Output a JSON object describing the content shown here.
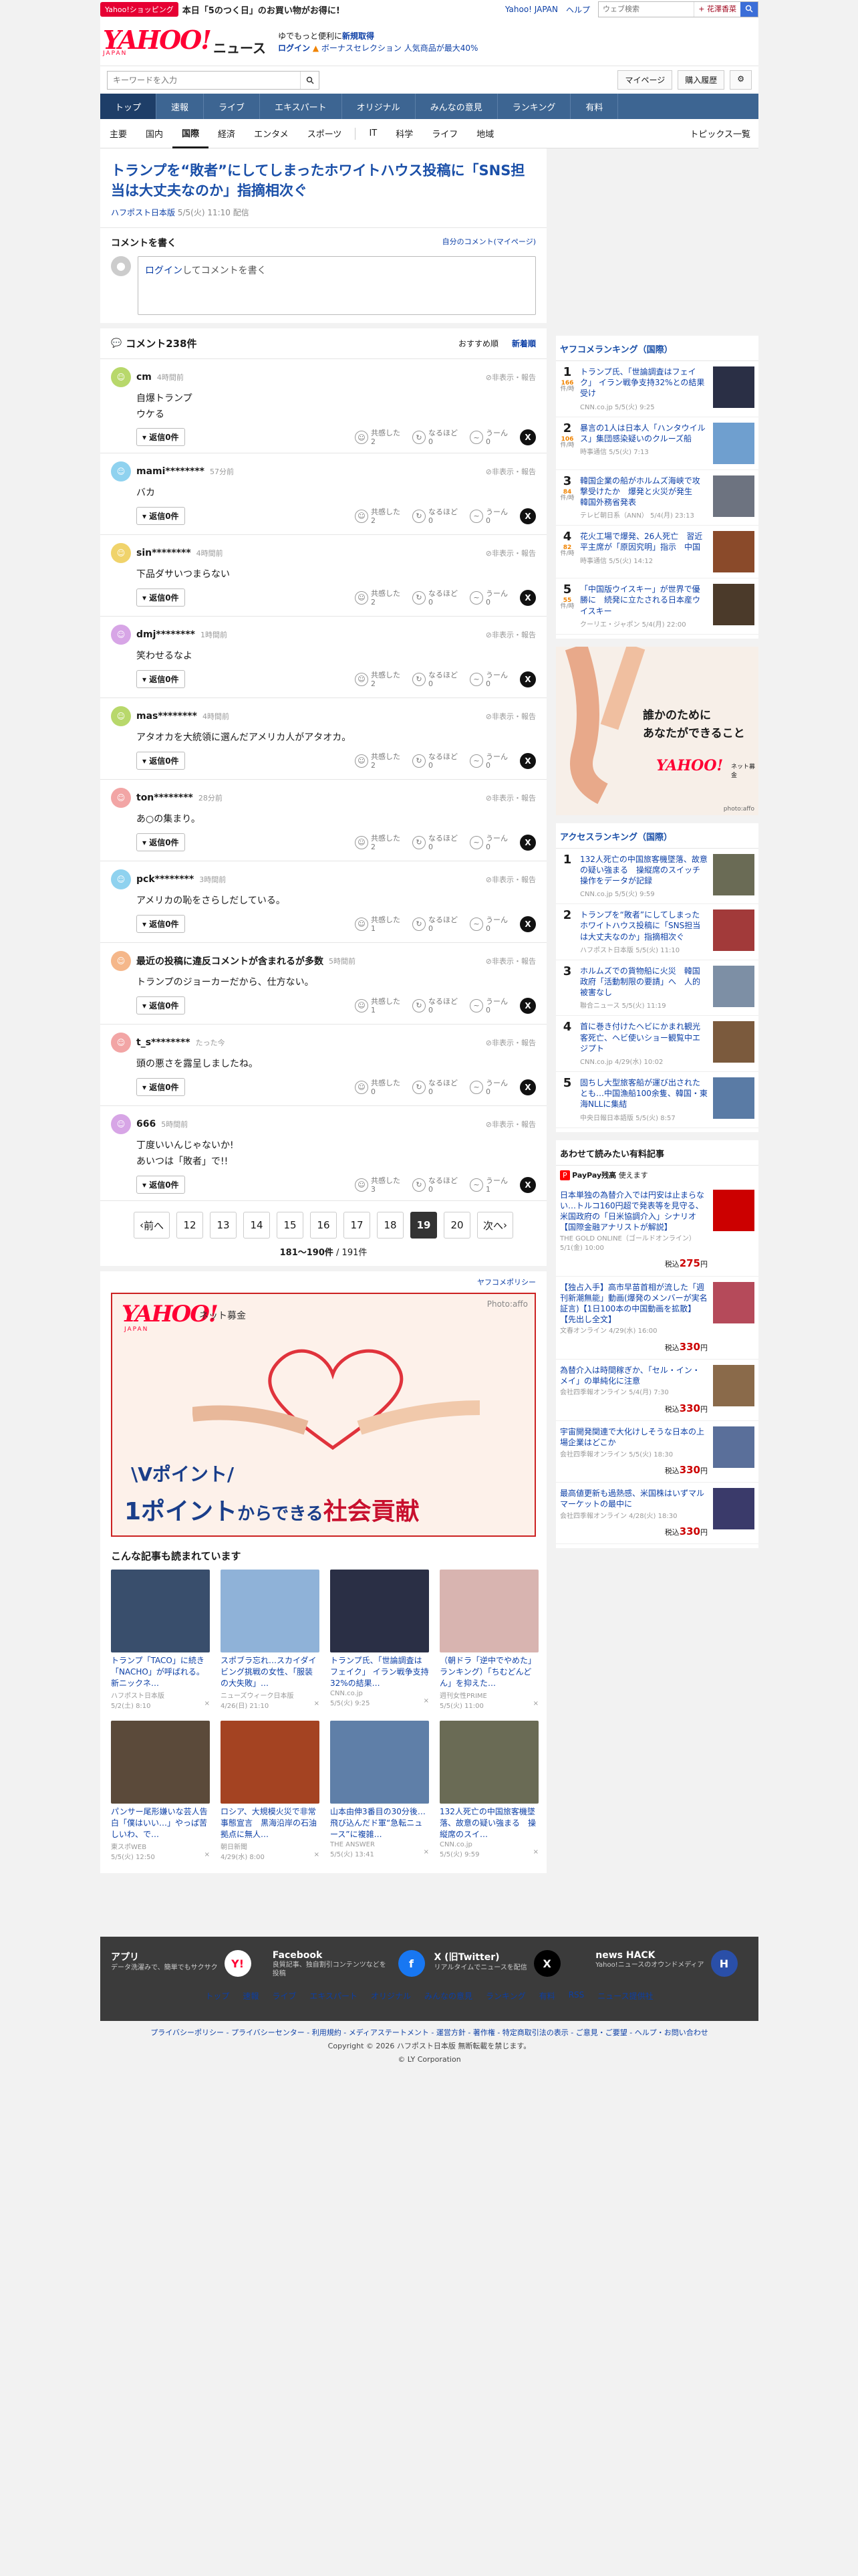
{
  "promo": {
    "badge": "Yahoo!ショッピング",
    "text": "本日「5のつく日」のお買い物がお得に!",
    "links": [
      "Yahoo! JAPAN",
      "ヘルプ"
    ],
    "search_placeholder": "ウェブ検索",
    "search_opt": "+ 花澤香菜"
  },
  "header": {
    "logo": "YAHOO!",
    "logo_sub": "JAPAN",
    "service": "ニュース",
    "msg1_a": "ゆでもっと便利に",
    "msg1_b": "新規取得",
    "msg2_login": "ログイン",
    "msg2_b": "ボーナスセレクション 人気商品が最大40%"
  },
  "search": {
    "placeholder": "キーワードを入力",
    "mypage": "マイページ",
    "purchase": "購入履歴"
  },
  "nav1": [
    "トップ",
    "速報",
    "ライブ",
    "エキスパート",
    "オリジナル",
    "みんなの意見",
    "ランキング",
    "有料"
  ],
  "nav2": [
    "主要",
    "国内",
    "国際",
    "経済",
    "エンタメ",
    "スポーツ",
    "IT",
    "科学",
    "ライフ",
    "地域"
  ],
  "nav2_topics": "トピックス一覧",
  "article": {
    "title": "トランプを“敗者”にしてしまったホワイトハウス投稿に「SNS担当は大丈夫なのか」指摘相次ぐ",
    "source": "ハフポスト日本版",
    "date": "5/5(火) 11:10 配信"
  },
  "comment_write": {
    "title": "コメントを書く",
    "mine": "自分のコメント(マイページ)",
    "login": "ログイン",
    "placeholder": "してコメントを書く"
  },
  "comments_header": {
    "count": "コメント238件",
    "sort_a": "おすすめ順",
    "sort_b": "新着順"
  },
  "comments": [
    {
      "user": "cm",
      "when": "4時間前",
      "body": "自爆トランプ\nウケる",
      "reply": "返信0件",
      "agree": "2",
      "deep": "0",
      "hmm": "0",
      "color": "#b8d86b"
    },
    {
      "user": "mami********",
      "when": "57分前",
      "body": "バカ",
      "reply": "返信0件",
      "agree": "2",
      "deep": "0",
      "hmm": "0",
      "color": "#8fd2ef"
    },
    {
      "user": "sin********",
      "when": "4時間前",
      "body": "下品ダサいつまらない",
      "reply": "返信0件",
      "agree": "2",
      "deep": "0",
      "hmm": "0",
      "color": "#f0d36b"
    },
    {
      "user": "dmj********",
      "when": "1時間前",
      "body": "笑わせるなよ",
      "reply": "返信0件",
      "agree": "2",
      "deep": "0",
      "hmm": "0",
      "color": "#d7a5e6"
    },
    {
      "user": "mas********",
      "when": "4時間前",
      "body": "アタオカを大統領に選んだアメリカ人がアタオカ。",
      "reply": "返信0件",
      "agree": "2",
      "deep": "0",
      "hmm": "0",
      "color": "#b8d86b"
    },
    {
      "user": "ton********",
      "when": "28分前",
      "body": "あ○の集まり。",
      "reply": "返信0件",
      "agree": "2",
      "deep": "0",
      "hmm": "0",
      "color": "#f2a5a5"
    },
    {
      "user": "pck********",
      "when": "3時間前",
      "body": "アメリカの恥をさらしだしている。",
      "reply": "返信0件",
      "agree": "1",
      "deep": "0",
      "hmm": "0",
      "color": "#8fd2ef"
    },
    {
      "user": "最近の投稿に違反コメントが含まれるが多数",
      "when": "5時間前",
      "body": "トランプのジョーカーだから、仕方ない。",
      "reply": "返信0件",
      "agree": "1",
      "deep": "0",
      "hmm": "0",
      "color": "#f5b78a"
    },
    {
      "user": "t_s********",
      "when": "たった今",
      "body": "頭の悪さを露呈しましたね。",
      "reply": "返信0件",
      "agree": "0",
      "deep": "0",
      "hmm": "0",
      "color": "#f2a5a5"
    },
    {
      "user": "666",
      "when": "5時間前",
      "body": "丁度いいんじゃないか!\nあいつは「敗者」で!!",
      "reply": "返信0件",
      "agree": "3",
      "deep": "0",
      "hmm": "1",
      "color": "#d7a5e6"
    }
  ],
  "reaction_labels": {
    "agree": "共感した",
    "deep": "なるほど",
    "hmm": "うーん",
    "hide": "非表示・報告"
  },
  "pager": {
    "prev": "前へ",
    "next": "次へ",
    "pages": [
      "12",
      "13",
      "14",
      "15",
      "16",
      "17",
      "18",
      "19",
      "20"
    ],
    "current": "19",
    "count": "181〜190件",
    "total": "/ 191件"
  },
  "ad_policy": "ヤフコメポリシー",
  "bigad": {
    "logo": "YAHOO!",
    "logo_sub": "JAPAN",
    "name": "ネット募金",
    "photo": "Photo:affo",
    "l1": "\\Vポイント/",
    "l2a": "1ポイント",
    "l2b": "からできる",
    "l2c": "社会貢献"
  },
  "reads": {
    "title": "こんな記事も読まれています",
    "items": [
      {
        "t": "トランプ「TACO」に続き「NACHO」が呼ばれる。新ニックネ…",
        "s": "ハフポスト日本版",
        "d": "5/2(土) 8:10",
        "c": "#394e6c"
      },
      {
        "t": "スポブラ忘れ…スカイダイビング挑戦の女性、「服装の大失敗」…",
        "s": "ニューズウィーク日本版",
        "d": "4/26(日) 21:10",
        "c": "#8fb2d8"
      },
      {
        "t": "トランプ氏、「世論調査はフェイク」 イラン戦争支持32%の結果…",
        "s": "CNN.co.jp",
        "d": "5/5(火) 9:25",
        "c": "#2a2f45"
      },
      {
        "t": "（朝ドラ「逆中でやめた」ランキング）「ちむどんどん」を抑えた…",
        "s": "週刊女性PRIME",
        "d": "5/5(火) 11:00",
        "c": "#d8b4b0"
      },
      {
        "t": "パンサー尾形嫌いな芸人告白「僕はいい…」やっぱ苦しいわ、で…",
        "s": "東スポWEB",
        "d": "5/5(火) 12:50",
        "c": "#5b4a3a"
      },
      {
        "t": "ロシア、大規模火災で非常事態宣言　黒海沿岸の石油拠点に無人…",
        "s": "朝日新聞",
        "d": "4/29(水) 8:00",
        "c": "#a44322"
      },
      {
        "t": "山本由伸3番目の30分後…飛び込んだド軍“急転ニュース”に複雑…",
        "s": "THE ANSWER",
        "d": "5/5(火) 13:41",
        "c": "#5f7fa8"
      },
      {
        "t": "132人死亡の中国旅客機墜落、故意の疑い強まる　操縦席のスイ…",
        "s": "CNN.co.jp",
        "d": "5/5(火) 9:59",
        "c": "#6a6b55"
      }
    ]
  },
  "ranking_yc": {
    "title": "ヤフコメランキング（国際）",
    "items": [
      {
        "n": "1",
        "c": "166",
        "t": "トランプ氏、「世論調査はフェイク」 イラン戦争支持32%との結果受け",
        "s": "CNN.co.jp 5/5(火) 9:25",
        "col": "#2a2f45"
      },
      {
        "n": "2",
        "c": "106",
        "t": "暴言の1人は日本人「ハンタウイルス」集団感染疑いのクルーズ船",
        "s": "時事通信 5/5(火) 7:13",
        "col": "#6f9fcf"
      },
      {
        "n": "3",
        "c": "84",
        "t": "韓国企業の船がホルムズ海峡で攻撃受けたか　爆発と火災が発生　韓国外務省発表",
        "s": "テレビ朝日系（ANN） 5/4(月) 23:13",
        "col": "#6d7380"
      },
      {
        "n": "4",
        "c": "82",
        "t": "花火工場で爆発、26人死亡　習近平主席が「原因究明」指示　中国",
        "s": "時事通信 5/5(火) 14:12",
        "col": "#8a4a2a"
      },
      {
        "n": "5",
        "c": "55",
        "t": "「中国版ウイスキー」が世界で優勝に　続発に立たされる日本産ウイスキー",
        "s": "クーリエ・ジャポン 5/4(月) 22:00",
        "col": "#4b3a2a"
      }
    ]
  },
  "sidead": {
    "l1": "誰かのために",
    "l2": "あなたができること",
    "logo": "YAHOO!",
    "logo2": "JAPAN",
    "sub": "ネット募金",
    "credit": "photo:affo"
  },
  "ranking_ac": {
    "title": "アクセスランキング（国際）",
    "items": [
      {
        "n": "1",
        "t": "132人死亡の中国旅客機墜落、故意の疑い強まる　操縦席のスイッチ操作をデータが記録",
        "s": "CNN.co.jp 5/5(火) 9:59",
        "col": "#6a6b55"
      },
      {
        "n": "2",
        "t": "トランプを“敗者”にしてしまったホワイトハウス投稿に「SNS担当は大丈夫なのか」指摘相次ぐ",
        "s": "ハフポスト日本版 5/5(火) 11:10",
        "col": "#a23a3a"
      },
      {
        "n": "3",
        "t": "ホルムズでの貨物船に火災　韓国政府「活動制限の要請」へ　人的被害なし",
        "s": "聯合ニュース 5/5(火) 11:19",
        "col": "#7d8fa5"
      },
      {
        "n": "4",
        "t": "首に巻き付けたヘビにかまれ観光客死亡、ヘビ使いショー観覧中エジプト",
        "s": "CNN.co.jp 4/29(水) 10:02",
        "col": "#7b5a3d"
      },
      {
        "n": "5",
        "t": "固ちし大型旅客船が運び出されたとも…中国漁船100余隻、韓国・東海NLLに集結",
        "s": "中央日報日本語版 5/5(火) 8:57",
        "col": "#5a7ba5"
      }
    ]
  },
  "products": {
    "title": "あわせて読みたい有料記事",
    "pp": "PayPay残高",
    "pp2": "使えます",
    "items": [
      {
        "t": "日本単独の為替介入では円安は止まらない…トルコ160円超で発表等を見守る、米国政府の「日米協調介入」シナリオ【国際金融アナリストが解説】",
        "s": "THE GOLD ONLINE（ゴールドオンライン） 5/1(金) 10:00",
        "p": "275",
        "col": "#c00"
      },
      {
        "t": "【独占入手】高市早苗首相が流した「週刊新潮無能」動画(爆発のメンバーが実名証言)【1日100本の中国動画を拡散】【先出し全文】",
        "s": "文春オンライン 4/29(水) 16:00",
        "p": "330",
        "col": "#b54a5a"
      },
      {
        "t": "為替介入は時間稼ぎか、「セル・イン・メイ」の単純化に注意",
        "s": "会社四季報オンライン 5/4(月) 7:30",
        "p": "330",
        "col": "#8a6a4a"
      },
      {
        "t": "宇宙開発関連で大化けしそうな日本の上場企業はどこか",
        "s": "会社四季報オンライン 5/5(火) 18:30",
        "p": "330",
        "col": "#5a6f9a"
      },
      {
        "t": "最高値更新も過熱感、米国株はいずマルマーケットの最中に",
        "s": "会社四季報オンライン 4/28(火) 18:30",
        "p": "330",
        "col": "#3a3a6a"
      }
    ]
  },
  "footer": {
    "apps": [
      {
        "name": "アプリ",
        "desc": "データ洗濯みで、簡単でもサクサク",
        "ic": "Y!",
        "bg": "#fff",
        "fg": "#ff0033"
      },
      {
        "name": "Facebook",
        "desc": "良質記事、独自割引コンテンツなどを投稿",
        "ic": "f",
        "bg": "#1877f2",
        "fg": "#fff"
      },
      {
        "name": "X (旧Twitter)",
        "desc": "リアルタイムでニュースを配信",
        "ic": "X",
        "bg": "#000",
        "fg": "#fff"
      },
      {
        "name": "news HACK",
        "desc": "Yahoo!ニュースのオウンドメディア",
        "ic": "H",
        "bg": "#2a4fa8",
        "fg": "#fff"
      }
    ],
    "links": [
      "トップ",
      "速報",
      "ライブ",
      "エキスパート",
      "オリジナル",
      "みんなの意見",
      "ランキング",
      "有料",
      "RSS",
      "ニュース提供社"
    ],
    "policy": "プライバシーポリシー - プライバシーセンター - 利用規約 - メディアステートメント - 運営方針 - 著作権 - 特定商取引法の表示 - ご意見・ご要望 - ヘルプ・お問い合わせ",
    "copy": "Copyright © 2026 ハフポスト日本版 無断転載を禁じます。",
    "copy2": "© LY Corporation"
  },
  "colors": {
    "accent": "#0c3fa6",
    "nav": "#3d6592",
    "brand": "#ff0033"
  }
}
